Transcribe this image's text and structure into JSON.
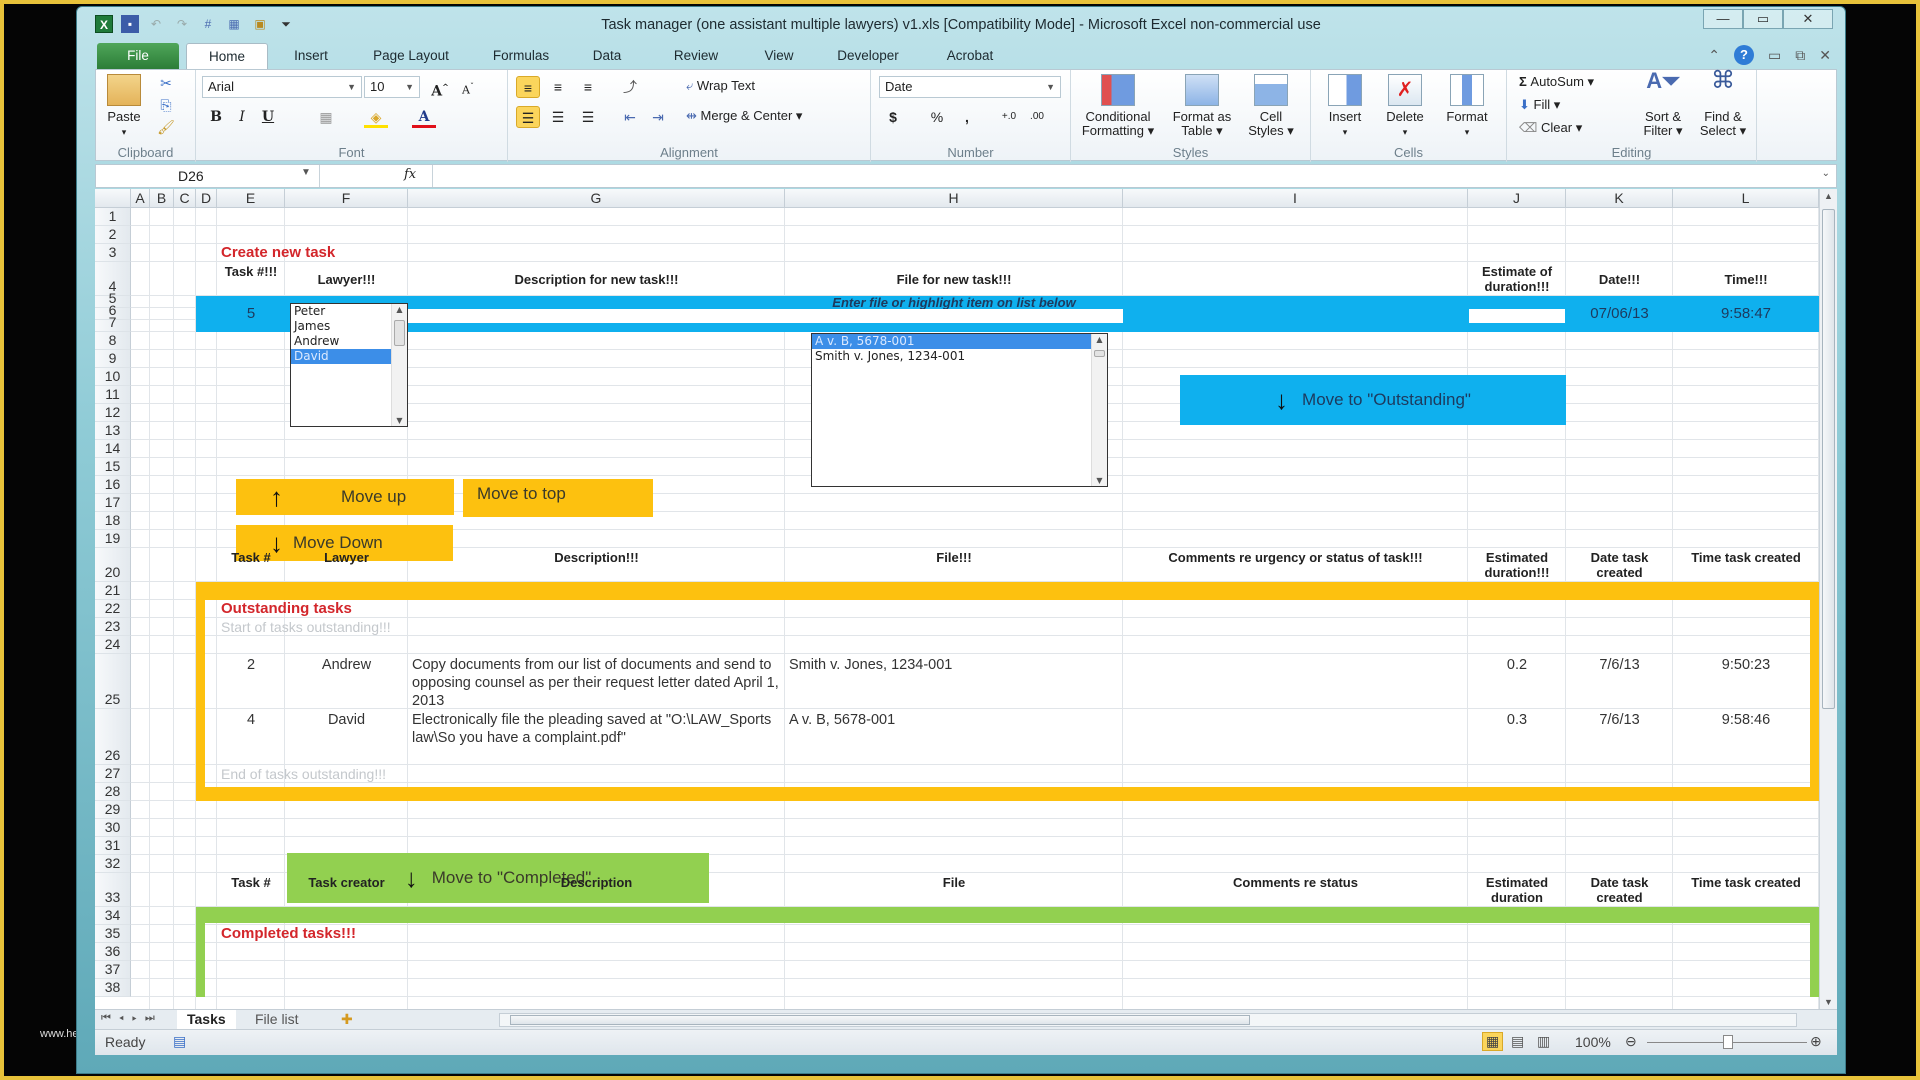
{
  "window": {
    "title": "Task manager (one assistant multiple lawyers) v1.xls  [Compatibility Mode]  -  Microsoft Excel non-commercial use",
    "controls": {
      "minimize": "—",
      "maximize": "▭",
      "close": "✕"
    }
  },
  "watermark": "www.herita",
  "ribbon_tabs": [
    "File",
    "Home",
    "Insert",
    "Page Layout",
    "Formulas",
    "Data",
    "Review",
    "View",
    "Developer",
    "Acrobat"
  ],
  "active_tab": "Home",
  "ribbon": {
    "clipboard": {
      "paste": "Paste",
      "label": "Clipboard"
    },
    "font": {
      "name": "Arial",
      "size": "10",
      "bold": "B",
      "italic": "I",
      "underline": "U",
      "label": "Font"
    },
    "alignment": {
      "wrap_text": "Wrap Text",
      "merge_center": "Merge & Center",
      "label": "Alignment"
    },
    "number": {
      "format": "Date",
      "currency": "$",
      "percent": "%",
      "comma": ",",
      "inc_dec": ".00",
      "label": "Number"
    },
    "styles": {
      "conditional": "Conditional Formatting",
      "format_table": "Format as Table",
      "cell_styles": "Cell Styles",
      "label": "Styles"
    },
    "cells": {
      "insert": "Insert",
      "delete": "Delete",
      "format": "Format",
      "label": "Cells"
    },
    "editing": {
      "autosum": "AutoSum",
      "fill": "Fill",
      "clear": "Clear",
      "sort_filter": "Sort & Filter",
      "find_select": "Find & Select",
      "label": "Editing"
    }
  },
  "formula_bar": {
    "name_box": "D26",
    "fx": "fx",
    "value": ""
  },
  "columns": [
    "A",
    "B",
    "C",
    "D",
    "E",
    "F",
    "G",
    "H",
    "I",
    "J",
    "K",
    "L"
  ],
  "rows": [
    "1",
    "2",
    "3",
    "4",
    "5",
    "6",
    "7",
    "8",
    "9",
    "10",
    "11",
    "12",
    "13",
    "14",
    "15",
    "16",
    "17",
    "18",
    "19",
    "20",
    "21",
    "22",
    "23",
    "24",
    "25",
    "26",
    "27",
    "28",
    "29",
    "30",
    "31",
    "32",
    "33",
    "34",
    "35",
    "36",
    "37",
    "38"
  ],
  "create_section": {
    "title": "Create new task",
    "headers": {
      "task_no": "Task #!!!",
      "lawyer": "Lawyer!!!",
      "description": "Description for new task!!!",
      "file": "File for new task!!!",
      "estimate": "Estimate of duration!!!",
      "date": "Date!!!",
      "time": "Time!!!"
    },
    "file_hint": "Enter file or highlight item on list below",
    "task_no": "5",
    "date": "07/06/13",
    "time": "9:58:47",
    "lawyer_list": [
      "Peter",
      "James",
      "Andrew",
      "David"
    ],
    "lawyer_selected": "David",
    "file_list": [
      "A v. B, 5678-001",
      "Smith v. Jones, 1234-001"
    ],
    "file_selected": "A v. B, 5678-001",
    "move_outstanding": "Move to \"Outstanding\""
  },
  "buttons": {
    "move_up": "Move up",
    "move_to_top": "Move to top",
    "move_down": "Move Down",
    "move_completed": "Move to \"Completed\""
  },
  "outstanding": {
    "headers": {
      "task_no": "Task #",
      "lawyer": "Lawyer",
      "description": "Description!!!",
      "file": "File!!!",
      "comments": "Comments re urgency or status of task!!!",
      "duration": "Estimated duration!!!",
      "date": "Date task created",
      "time": "Time task created"
    },
    "title": "Outstanding tasks",
    "start_marker": "Start of tasks outstanding!!!",
    "end_marker": "End of tasks outstanding!!!",
    "tasks": [
      {
        "task_no": "2",
        "lawyer": "Andrew",
        "description": "Copy documents from our list of documents and send to opposing counsel as per their request letter dated April 1, 2013",
        "file": "Smith v. Jones, 1234-001",
        "comments": "",
        "duration": "0.2",
        "date": "7/6/13",
        "time": "9:50:23"
      },
      {
        "task_no": "4",
        "lawyer": "David",
        "description": "Electronically file the pleading saved at \"O:\\LAW_Sports law\\So you have a complaint.pdf\"",
        "file": "A v. B, 5678-001",
        "comments": "",
        "duration": "0.3",
        "date": "7/6/13",
        "time": "9:58:46"
      }
    ]
  },
  "completed": {
    "headers": {
      "task_no": "Task #",
      "creator": "Task creator",
      "description": "Description",
      "file": "File",
      "comments": "Comments re status",
      "duration": "Estimated duration",
      "date": "Date task created",
      "time": "Time task created"
    },
    "title": "Completed tasks!!!"
  },
  "sheet_tabs": [
    "Tasks",
    "File list"
  ],
  "active_sheet": "Tasks",
  "status": {
    "ready": "Ready",
    "zoom": "100%"
  },
  "colors": {
    "accent_blue": "#0fb0ee",
    "accent_yellow": "#fdc10f",
    "accent_green": "#92d050",
    "title_red": "#d3262b"
  }
}
